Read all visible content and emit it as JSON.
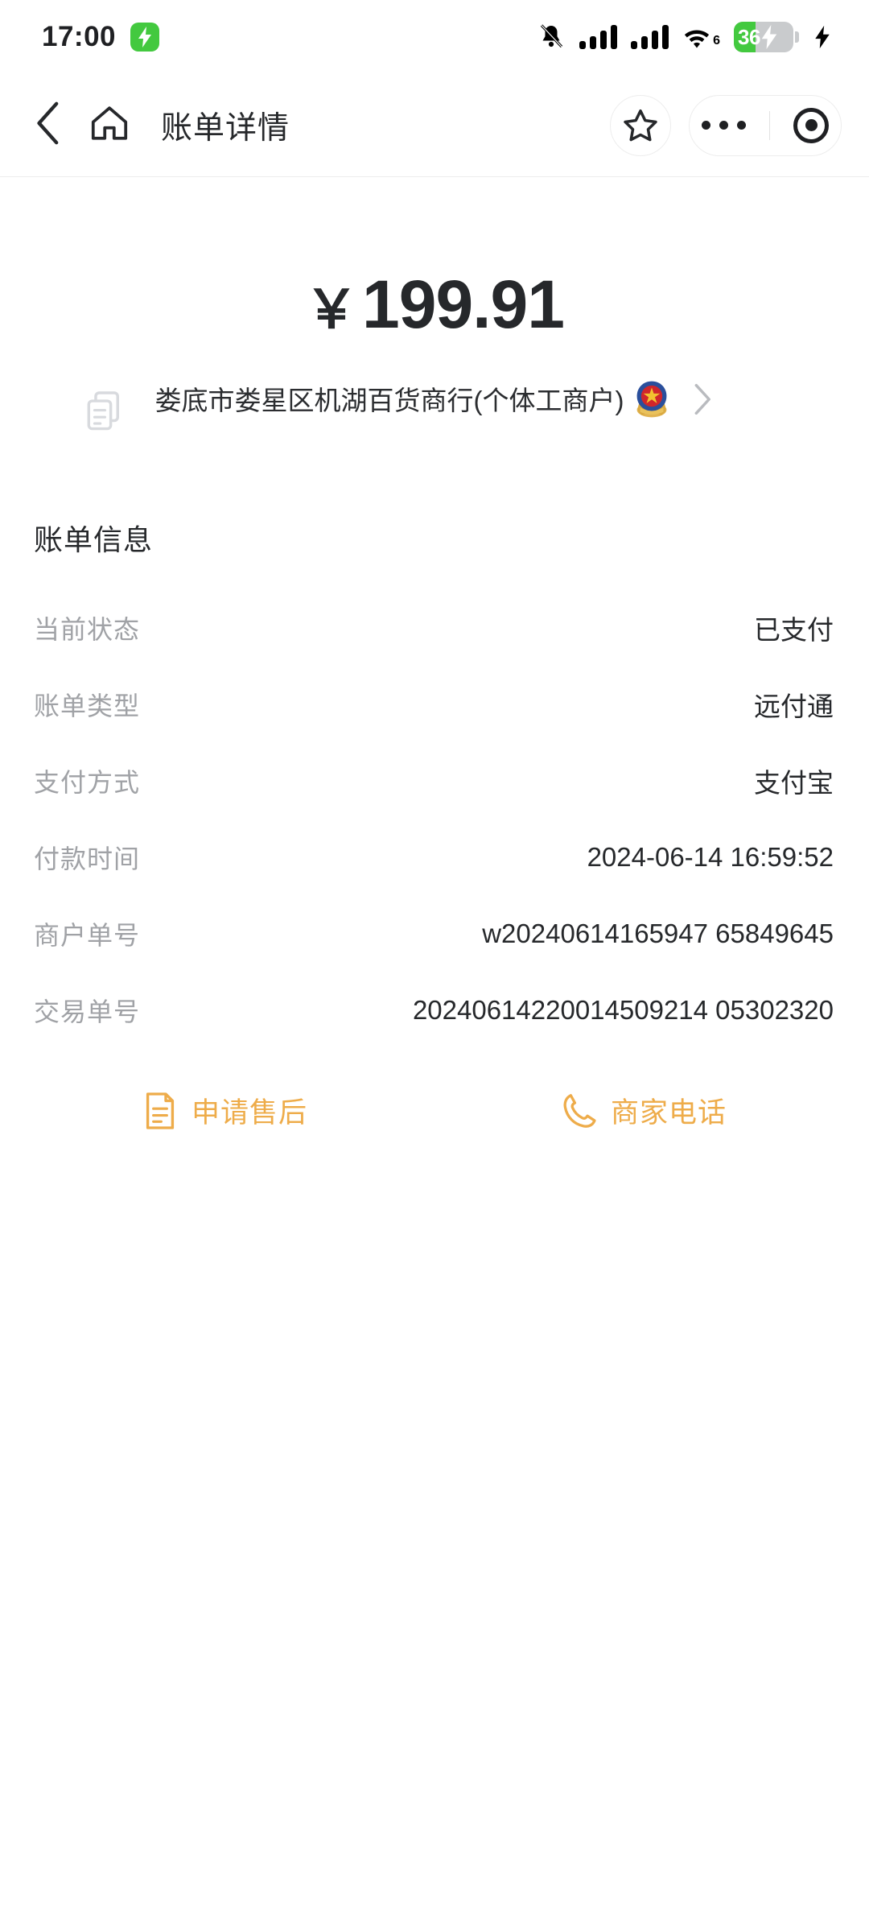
{
  "status_bar": {
    "time": "17:00",
    "charging_badge_icon": "lightning-bolt-icon",
    "mute_icon": "bell-muted-icon",
    "signal_1_icon": "cellular-signal-icon",
    "signal_2_icon": "cellular-signal-icon",
    "wifi_icon": "wifi-icon",
    "wifi_generation": "6",
    "battery_percent": "36",
    "battery_icon": "battery-charging-icon",
    "external_bolt_icon": "lightning-bolt-icon",
    "accent_green": "#43c93f"
  },
  "nav": {
    "back_icon": "chevron-left-icon",
    "home_icon": "home-icon",
    "title": "账单详情",
    "favorite_icon": "star-icon",
    "more_icon": "more-dots-icon",
    "close_icon": "target-circle-icon"
  },
  "summary": {
    "currency_symbol": "￥",
    "amount": "199.91",
    "copy_icon": "copy-icon",
    "merchant_name": "娄底市娄星区机湖百货商行(个体工商户)",
    "verified_badge_icon": "national-emblem-badge-icon",
    "chevron_icon": "chevron-right-icon"
  },
  "bill_info": {
    "section_title": "账单信息",
    "rows": [
      {
        "label": "当前状态",
        "value": "已支付"
      },
      {
        "label": "账单类型",
        "value": "远付通"
      },
      {
        "label": "支付方式",
        "value": "支付宝"
      },
      {
        "label": "付款时间",
        "value": "2024-06-14 16:59:52"
      },
      {
        "label": "商户单号",
        "value": "w20240614165947 65849645"
      },
      {
        "label": "交易单号",
        "value": "20240614220014509214 05302320"
      }
    ]
  },
  "actions": {
    "accent_color": "#eeac4a",
    "aftersales": {
      "label": "申请售后",
      "icon": "document-icon"
    },
    "merchant_phone": {
      "label": "商家电话",
      "icon": "phone-icon"
    }
  }
}
